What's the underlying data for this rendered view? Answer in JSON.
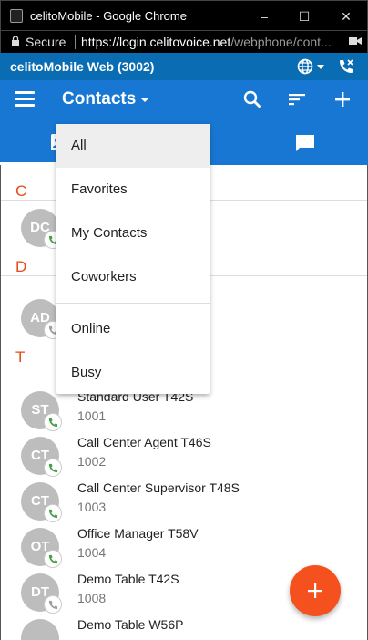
{
  "browser": {
    "window_title": "celitoMobile - Google Chrome",
    "secure_label": "Secure",
    "url_host": "https://login.celitovoice.net",
    "url_path": "/webphone/cont..."
  },
  "app": {
    "name": "celitoMobile Web (3002)",
    "heading": "Contacts"
  },
  "tabs": [
    {
      "name": "contacts",
      "icon": "contacts-icon",
      "active": true
    },
    {
      "name": "call-history",
      "icon": "call-history-icon",
      "active": false
    },
    {
      "name": "chat",
      "icon": "chat-icon",
      "active": false
    }
  ],
  "filter_menu": {
    "items": [
      "All",
      "Favorites",
      "My Contacts",
      "Coworkers",
      "Online",
      "Busy"
    ],
    "selected": "All"
  },
  "sections": {
    "c": "C",
    "d": "D",
    "t": "T"
  },
  "contacts": [
    {
      "initials": "DC",
      "name": "",
      "ext": ""
    },
    {
      "initials": "AD",
      "name": "",
      "ext": ""
    },
    {
      "initials": "ST",
      "name": "Standard User T42S",
      "ext": "1001"
    },
    {
      "initials": "CT",
      "name": "Call Center Agent T46S",
      "ext": "1002"
    },
    {
      "initials": "CT",
      "name": "Call Center Supervisor T48S",
      "ext": "1003"
    },
    {
      "initials": "OT",
      "name": "Office Manager T58V",
      "ext": "1004"
    },
    {
      "initials": "DT",
      "name": "Demo Table T42S",
      "ext": "1008"
    },
    {
      "initials": "",
      "name": "Demo Table W56P",
      "ext": ""
    }
  ],
  "colors": {
    "app_bar": "#1877d2",
    "app_top": "#0a6db3",
    "accent": "#f4511e",
    "section_letter": "#e64a19",
    "status_available": "#43a047",
    "status_unknown": "#9e9e9e"
  }
}
